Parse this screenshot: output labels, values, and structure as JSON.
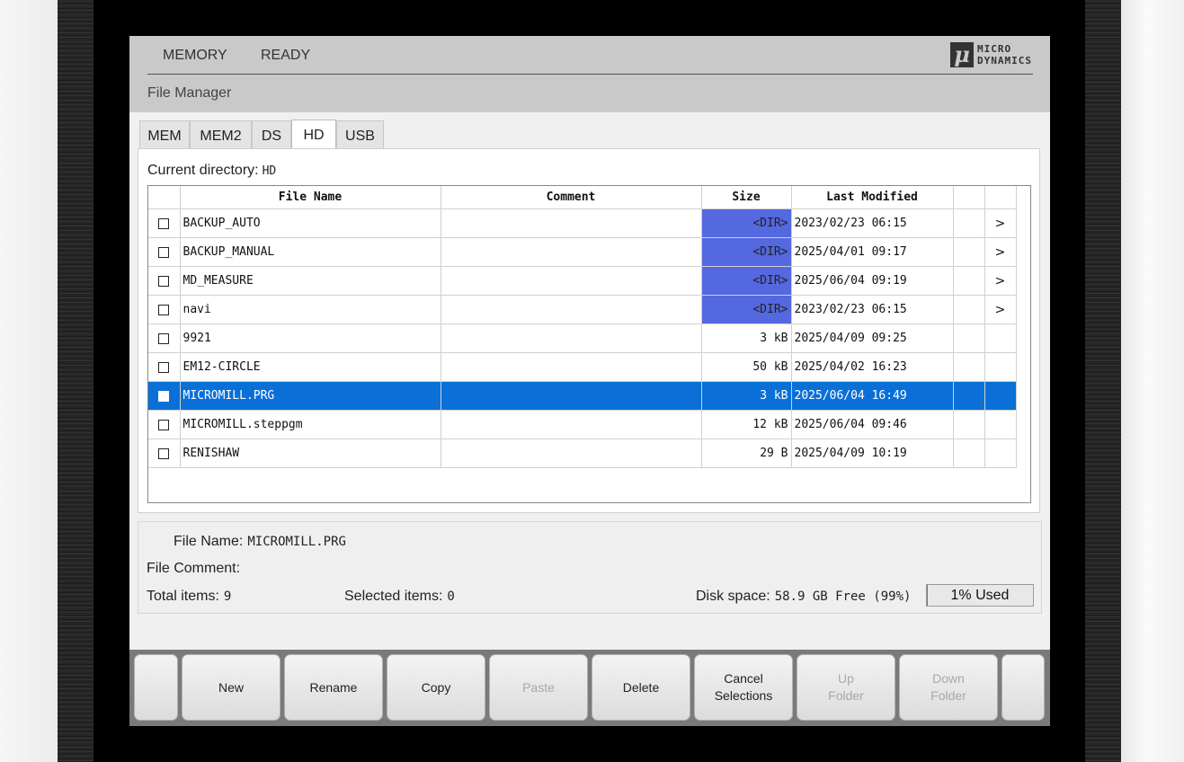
{
  "header": {
    "mode": "MEMORY",
    "state": "READY",
    "page_title": "File Manager",
    "logo": {
      "mark": "μ",
      "line1": "MICRO",
      "line2": "DYNAMICS"
    }
  },
  "tabs": [
    {
      "label": "MEM",
      "active": false
    },
    {
      "label": "MEM2",
      "active": false
    },
    {
      "label": "DS",
      "active": false
    },
    {
      "label": "HD",
      "active": true
    },
    {
      "label": "USB",
      "active": false
    }
  ],
  "current_directory": {
    "label": "Current directory:",
    "value": "HD"
  },
  "table": {
    "columns": [
      "File Name",
      "Comment",
      "Size",
      "Last Modified"
    ],
    "rows": [
      {
        "name": "BACKUP_AUTO",
        "comment": "",
        "size": "<DIR>",
        "modified": "2023/02/23 06:15",
        "folder": true,
        "selected": false
      },
      {
        "name": "BACKUP_MANUAL",
        "comment": "",
        "size": "<DIR>",
        "modified": "2025/04/01 09:17",
        "folder": true,
        "selected": false
      },
      {
        "name": "MD_MEASURE",
        "comment": "",
        "size": "<DIR>",
        "modified": "2025/06/04 09:19",
        "folder": true,
        "selected": false
      },
      {
        "name": "navi",
        "comment": "",
        "size": "<DIR>",
        "modified": "2023/02/23 06:15",
        "folder": true,
        "selected": false
      },
      {
        "name": "9921",
        "comment": "",
        "size": "3 kB",
        "modified": "2025/04/09 09:25",
        "folder": false,
        "selected": false
      },
      {
        "name": "EM12-CIRCLE",
        "comment": "",
        "size": "50 kB",
        "modified": "2025/04/02 16:23",
        "folder": false,
        "selected": false
      },
      {
        "name": "MICROMILL.PRG",
        "comment": "",
        "size": "3 kB",
        "modified": "2025/06/04 16:49",
        "folder": false,
        "selected": true
      },
      {
        "name": "MICROMILL.steppgm",
        "comment": "",
        "size": "12 kB",
        "modified": "2025/06/04 09:46",
        "folder": false,
        "selected": false
      },
      {
        "name": "RENISHAW",
        "comment": "",
        "size": "29 B",
        "modified": "2025/04/09 10:19",
        "folder": false,
        "selected": false
      }
    ],
    "folder_arrow": ">"
  },
  "info": {
    "file_name_label": "File Name:",
    "file_name_value": "MICROMILL.PRG",
    "file_comment_label": "File Comment:",
    "file_comment_value": "",
    "total_items_label": "Total items:",
    "total_items_value": "9",
    "selected_items_label": "Selected items:",
    "selected_items_value": "0",
    "disk_space_label": "Disk space:",
    "disk_space_value": "58.9 GB Free (99%)",
    "disk_used_label": "1% Used",
    "disk_used_fraction": 0.01
  },
  "softkeys": [
    {
      "label": "",
      "enabled": true
    },
    {
      "label": "New",
      "enabled": true
    },
    {
      "label": "Rename",
      "enabled": true
    },
    {
      "label": "Copy",
      "enabled": true
    },
    {
      "label": "Paste",
      "enabled": false
    },
    {
      "label": "Delete",
      "enabled": true
    },
    {
      "label": "Cancel\nSelections",
      "enabled": true
    },
    {
      "label": "Up\nFolder",
      "enabled": false
    },
    {
      "label": "Down\nFolder",
      "enabled": false
    },
    {
      "label": "",
      "enabled": true
    }
  ],
  "colors": {
    "selected_row": "#0a70d8",
    "dir_size_cell": "#5468e0",
    "softkey_bar": "#7a7a7a",
    "header_bg": "#c9c9c9"
  }
}
